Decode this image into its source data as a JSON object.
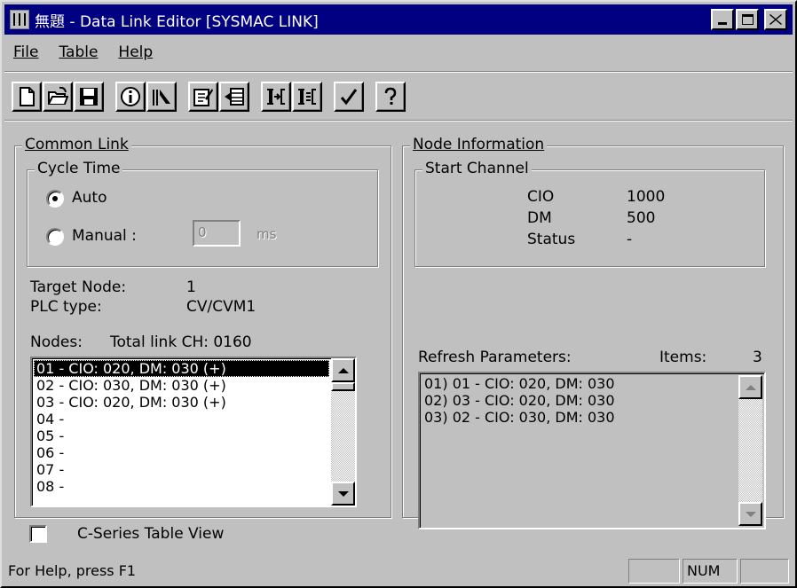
{
  "window": {
    "title": "無題 - Data Link Editor [SYSMAC LINK]"
  },
  "menu": {
    "file_label": "File",
    "table_label": "Table",
    "help_label": "Help"
  },
  "toolbar": {
    "icons": [
      "new-file-icon",
      "open-folder-icon",
      "save-icon",
      "info-icon",
      "pointer-help-icon",
      "edit-table-icon",
      "insert-table-icon",
      "link-add-icon",
      "link-refresh-icon",
      "check-icon",
      "question-icon"
    ]
  },
  "common_link": {
    "group_label": "Common Link",
    "cycle_time": {
      "group_label": "Cycle Time",
      "auto_label": "Auto",
      "manual_label": "Manual :",
      "manual_value": "0",
      "unit": "ms",
      "selected": "Auto"
    },
    "target_node_label": "Target Node:",
    "target_node_value": "1",
    "plc_type_label": "PLC type:",
    "plc_type_value": "CV/CVM1",
    "nodes_label": "Nodes:",
    "total_link_label": "Total link CH: 0160",
    "nodes": [
      "01 - CIO: 020, DM: 030 (+)",
      "02 - CIO: 030, DM: 030 (+)",
      "03 - CIO: 020, DM: 030 (+)",
      "04 -",
      "05 -",
      "06 -",
      "07 -",
      "08 -"
    ],
    "selected_node_index": 0
  },
  "node_information": {
    "group_label": "Node Information",
    "start_channel": {
      "group_label": "Start Channel",
      "cio_label": "CIO",
      "cio_value": "1000",
      "dm_label": "DM",
      "dm_value": "500",
      "status_label": "Status",
      "status_value": "-"
    },
    "refresh_label": "Refresh Parameters:",
    "items_label": "Items:",
    "items_value": "3",
    "refresh_params": [
      "01) 01 - CIO: 020, DM: 030",
      "02) 03 - CIO: 020, DM: 030",
      "03) 02 - CIO: 030, DM: 030"
    ]
  },
  "cseries_view_label": "C-Series Table View",
  "cseries_view_checked": false,
  "status_bar": {
    "help_text": "For Help, press F1",
    "num_indicator": "NUM"
  }
}
